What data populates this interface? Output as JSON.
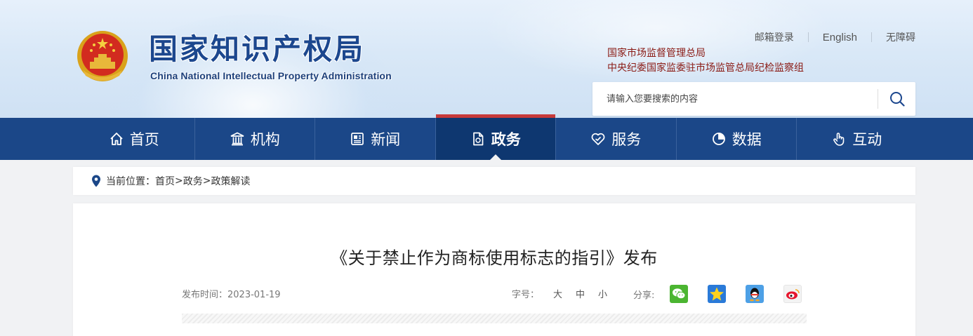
{
  "header": {
    "site_title": "国家知识产权局",
    "site_subtitle": "China National Intellectual Property Administration",
    "top_links": {
      "mail_login": "邮箱登录",
      "english": "English",
      "accessibility": "无障碍"
    },
    "org_links": [
      "国家市场监督管理总局",
      "中央纪委国家监委驻市场监管总局纪检监察组"
    ],
    "search": {
      "placeholder": "请输入您要搜索的内容"
    }
  },
  "nav": {
    "items": [
      {
        "label": "首页",
        "icon": "home-icon"
      },
      {
        "label": "机构",
        "icon": "institution-icon"
      },
      {
        "label": "新闻",
        "icon": "news-icon"
      },
      {
        "label": "政务",
        "icon": "document-icon",
        "active": true
      },
      {
        "label": "服务",
        "icon": "service-icon"
      },
      {
        "label": "数据",
        "icon": "pie-chart-icon"
      },
      {
        "label": "互动",
        "icon": "hand-pointer-icon"
      }
    ]
  },
  "breadcrumb": {
    "prefix": "当前位置：",
    "items": [
      "首页",
      "政务",
      "政策解读"
    ],
    "separator": ">"
  },
  "article": {
    "title": "《关于禁止作为商标使用标志的指引》发布",
    "date_label": "发布时间：",
    "date": "2023-01-19",
    "font_size_label": "字号：",
    "font_sizes": [
      "大",
      "中",
      "小"
    ],
    "share_label": "分享:",
    "share_targets": [
      "wechat-icon",
      "qzone-icon",
      "qq-icon",
      "weibo-icon"
    ]
  },
  "colors": {
    "nav_bg": "#1b4788",
    "nav_active_bg": "#0e3770",
    "accent_red": "#c73a3a",
    "title_blue": "#1c478e",
    "org_link_red": "#8a1a14"
  }
}
